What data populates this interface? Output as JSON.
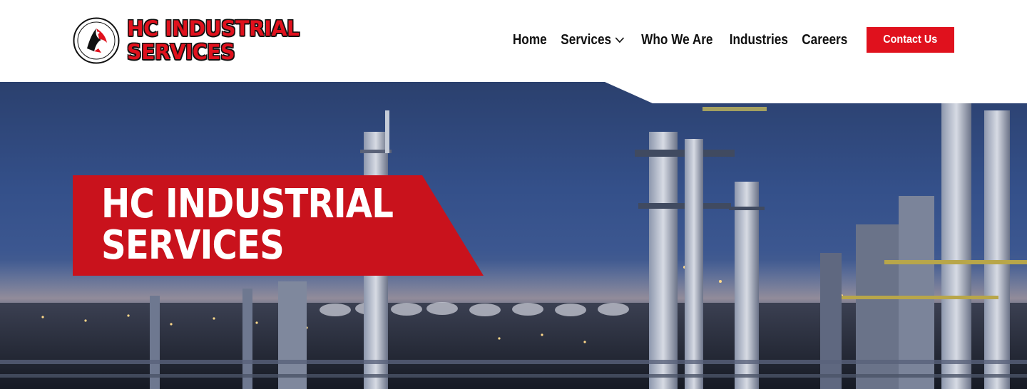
{
  "brand": {
    "name_line1": "HC INDUSTRIAL",
    "name_line2": "SERVICES",
    "logo_icon": "eagle-badge-icon",
    "primary_color": "#e0111d"
  },
  "nav": {
    "items": [
      {
        "label": "Home"
      },
      {
        "label": "Services",
        "icon": "chevron-down-icon"
      },
      {
        "label": "Who We Are"
      },
      {
        "label": "Industries"
      },
      {
        "label": "Careers"
      }
    ],
    "cta_label": "Contact Us"
  },
  "hero": {
    "title_line1": "HC INDUSTRIAL",
    "title_line2": "SERVICES",
    "background": "refinery-at-dusk-photo"
  }
}
